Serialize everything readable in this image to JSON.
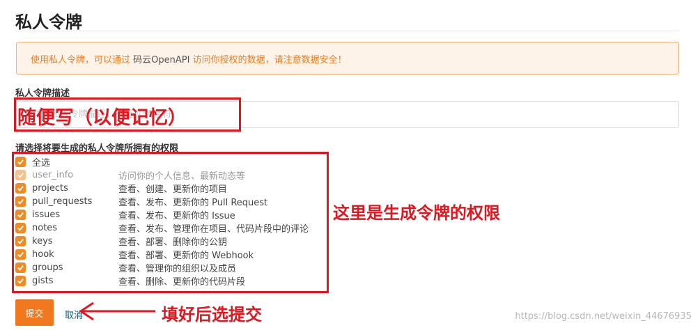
{
  "page": {
    "title": "私人令牌"
  },
  "notice": {
    "prefix": "使用私人令牌，可以通过 ",
    "link": "码云OpenAPI",
    "suffix": " 访问你授权的数据，请注意数据安全！"
  },
  "description": {
    "label": "私人令牌描述",
    "placeholder": "请输入私人令牌描述，不超过50字符"
  },
  "permissions": {
    "label": "请选择将要生成的私人令牌所拥有的权限",
    "select_all_label": "全选",
    "select_all_checked": true,
    "items": [
      {
        "name": "user_info",
        "desc": "访问你的个人信息、最新动态等",
        "checked": true,
        "disabled": true
      },
      {
        "name": "projects",
        "desc": "查看、创建、更新你的项目",
        "checked": true,
        "disabled": false
      },
      {
        "name": "pull_requests",
        "desc": "查看、发布、更新你的 Pull Request",
        "checked": true,
        "disabled": false
      },
      {
        "name": "issues",
        "desc": "查看、发布、更新你的 Issue",
        "checked": true,
        "disabled": false
      },
      {
        "name": "notes",
        "desc": "查看、发布、管理你在项目、代码片段中的评论",
        "checked": true,
        "disabled": false
      },
      {
        "name": "keys",
        "desc": "查看、部署、删除你的公钥",
        "checked": true,
        "disabled": false
      },
      {
        "name": "hook",
        "desc": "查看、部署、更新你的 Webhook",
        "checked": true,
        "disabled": false
      },
      {
        "name": "groups",
        "desc": "查看、管理你的组织以及成员",
        "checked": true,
        "disabled": false
      },
      {
        "name": "gists",
        "desc": "查看、删除、更新你的代码片段",
        "checked": true,
        "disabled": false
      }
    ]
  },
  "actions": {
    "submit_label": "提交",
    "cancel_label": "取消"
  },
  "annotations": {
    "description_note": "随便写（以便记忆）",
    "permissions_note": "这里是生成令牌的权限",
    "submit_note": "填好后选提交",
    "color": "#e1161e"
  },
  "watermark": "https://blog.csdn.net/weixin_44676935",
  "colors": {
    "accent": "#f0781e",
    "checkbox": "#f08a24",
    "notice_text": "#e67e22",
    "notice_bg": "#fdf3e8"
  }
}
